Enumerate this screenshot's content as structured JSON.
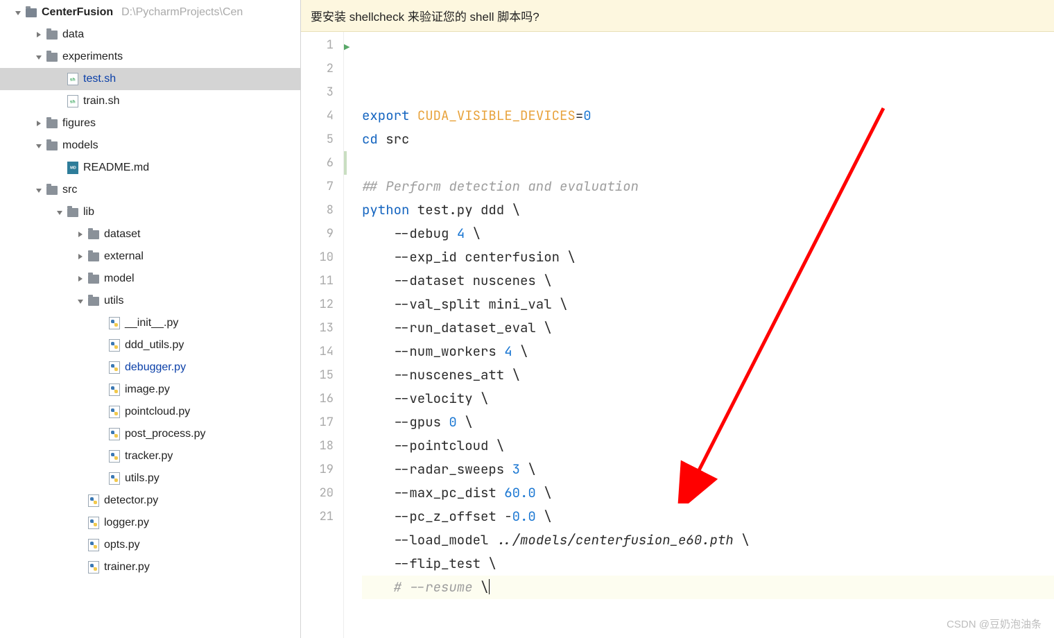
{
  "project": {
    "name": "CenterFusion",
    "path_tail": "D:\\PycharmProjects\\Cen"
  },
  "banner": "要安装 shellcheck 来验证您的 shell 脚本吗?",
  "watermark": "CSDN @豆奶泡油条",
  "tree": [
    {
      "depth": 0,
      "arrow": "down",
      "icon": "folder-root",
      "label": "CenterFusion",
      "bold": true,
      "path_tail": "D:\\PycharmProjects\\Cen"
    },
    {
      "depth": 1,
      "arrow": "right",
      "icon": "folder",
      "label": "data"
    },
    {
      "depth": 1,
      "arrow": "down",
      "icon": "folder",
      "label": "experiments"
    },
    {
      "depth": 2,
      "arrow": "",
      "icon": "sh",
      "label": "test.sh",
      "mod": true,
      "selected": true
    },
    {
      "depth": 2,
      "arrow": "",
      "icon": "sh",
      "label": "train.sh"
    },
    {
      "depth": 1,
      "arrow": "right",
      "icon": "folder",
      "label": "figures"
    },
    {
      "depth": 1,
      "arrow": "down",
      "icon": "folder",
      "label": "models"
    },
    {
      "depth": 2,
      "arrow": "",
      "icon": "md",
      "label": "README.md"
    },
    {
      "depth": 1,
      "arrow": "down",
      "icon": "folder",
      "label": "src"
    },
    {
      "depth": 2,
      "arrow": "down",
      "icon": "folder",
      "label": "lib"
    },
    {
      "depth": 3,
      "arrow": "right",
      "icon": "folder",
      "label": "dataset"
    },
    {
      "depth": 3,
      "arrow": "right",
      "icon": "folder",
      "label": "external"
    },
    {
      "depth": 3,
      "arrow": "right",
      "icon": "folder",
      "label": "model"
    },
    {
      "depth": 3,
      "arrow": "down",
      "icon": "folder",
      "label": "utils"
    },
    {
      "depth": 4,
      "arrow": "",
      "icon": "py",
      "label": "__init__.py"
    },
    {
      "depth": 4,
      "arrow": "",
      "icon": "py",
      "label": "ddd_utils.py"
    },
    {
      "depth": 4,
      "arrow": "",
      "icon": "py",
      "label": "debugger.py",
      "mod": true
    },
    {
      "depth": 4,
      "arrow": "",
      "icon": "py",
      "label": "image.py"
    },
    {
      "depth": 4,
      "arrow": "",
      "icon": "py",
      "label": "pointcloud.py"
    },
    {
      "depth": 4,
      "arrow": "",
      "icon": "py",
      "label": "post_process.py"
    },
    {
      "depth": 4,
      "arrow": "",
      "icon": "py",
      "label": "tracker.py"
    },
    {
      "depth": 4,
      "arrow": "",
      "icon": "py",
      "label": "utils.py"
    },
    {
      "depth": 3,
      "arrow": "",
      "icon": "py",
      "label": "detector.py"
    },
    {
      "depth": 3,
      "arrow": "",
      "icon": "py",
      "label": "logger.py"
    },
    {
      "depth": 3,
      "arrow": "",
      "icon": "py",
      "label": "opts.py"
    },
    {
      "depth": 3,
      "arrow": "",
      "icon": "py",
      "label": "trainer.py"
    }
  ],
  "code": {
    "lines": [
      {
        "n": 1,
        "html": "<span class='kw'>export</span> <span class='orange'>CUDA_VISIBLE_DEVICES</span>=<span class='num'>0</span>"
      },
      {
        "n": 2,
        "html": "<span class='cmd'>cd</span> src"
      },
      {
        "n": 3,
        "html": ""
      },
      {
        "n": 4,
        "html": "<span class='cmt'>## Perform detection and evaluation</span>"
      },
      {
        "n": 5,
        "html": "<span class='cmd'>python</span> test.py ddd \\"
      },
      {
        "n": 6,
        "html": "    --debug <span class='num'>4</span> \\"
      },
      {
        "n": 7,
        "html": "    --exp_id centerfusion \\"
      },
      {
        "n": 8,
        "html": "    --dataset nuscenes \\"
      },
      {
        "n": 9,
        "html": "    --val_split mini_val \\"
      },
      {
        "n": 10,
        "html": "    --run_dataset_eval \\"
      },
      {
        "n": 11,
        "html": "    --num_workers <span class='num'>4</span> \\"
      },
      {
        "n": 12,
        "html": "    --nuscenes_att \\"
      },
      {
        "n": 13,
        "html": "    --velocity \\"
      },
      {
        "n": 14,
        "html": "    --gpus <span class='num'>0</span> \\"
      },
      {
        "n": 15,
        "html": "    --pointcloud \\"
      },
      {
        "n": 16,
        "html": "    --radar_sweeps <span class='num'>3</span> \\"
      },
      {
        "n": 17,
        "html": "    --max_pc_dist <span class='num'>60.0</span> \\"
      },
      {
        "n": 18,
        "html": "    --pc_z_offset -<span class='num'>0.0</span> \\"
      },
      {
        "n": 19,
        "html": "    --load_model <span class='path'>../models/centerfusion_e60.pth</span> \\"
      },
      {
        "n": 20,
        "html": "    --flip_test \\"
      },
      {
        "n": 21,
        "html": "    <span class='cmt'># --resume </span>\\<span class='caret'></span>",
        "current": true
      }
    ]
  }
}
